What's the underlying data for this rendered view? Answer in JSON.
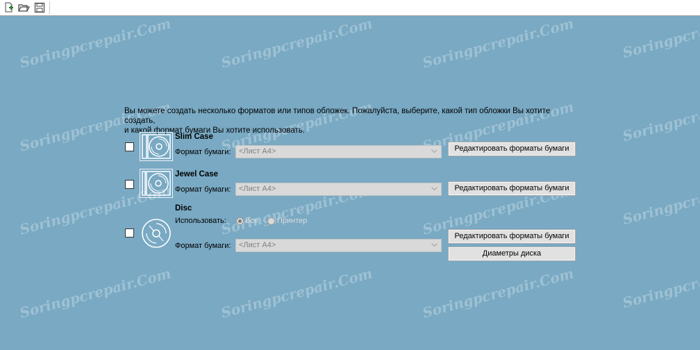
{
  "toolbar": {
    "buttons": [
      {
        "icon": "new-document-icon"
      },
      {
        "icon": "open-folder-icon"
      },
      {
        "icon": "save-disk-icon"
      }
    ]
  },
  "watermark": "Soringpcrepair.Com",
  "intro": {
    "line1": "Вы можете создать несколько форматов или типов обложек. Пожалуйста, выберите, какой тип обложки Вы хотите создать,",
    "line2": "и какой формат бумаги Вы хотите использовать."
  },
  "slim": {
    "title": "Slim Case",
    "paper_label": "Формат бумаги:",
    "paper_value": "<Лист А4>",
    "edit_button": "Редактировать форматы бумаги",
    "checked": false,
    "icon": "slim-case-icon"
  },
  "jewel": {
    "title": "Jewel Case",
    "paper_label": "Формат бумаги:",
    "paper_value": "<Лист А4>",
    "edit_button": "Редактировать форматы бумаги",
    "checked": false,
    "icon": "jewel-case-icon"
  },
  "disc": {
    "title": "Disc",
    "use_label": "Использовать:",
    "radio_all": "Все",
    "radio_printer": "Принтер",
    "selected": "Все",
    "paper_label": "Формат бумаги:",
    "paper_value": "<Лист А4>",
    "edit_button": "Редактировать форматы бумаги",
    "diameters_button": "Диаметры диска",
    "checked": false,
    "icon": "disc-icon"
  },
  "colors": {
    "background": "#79a9c3",
    "icon_stroke": "#ffffff"
  }
}
